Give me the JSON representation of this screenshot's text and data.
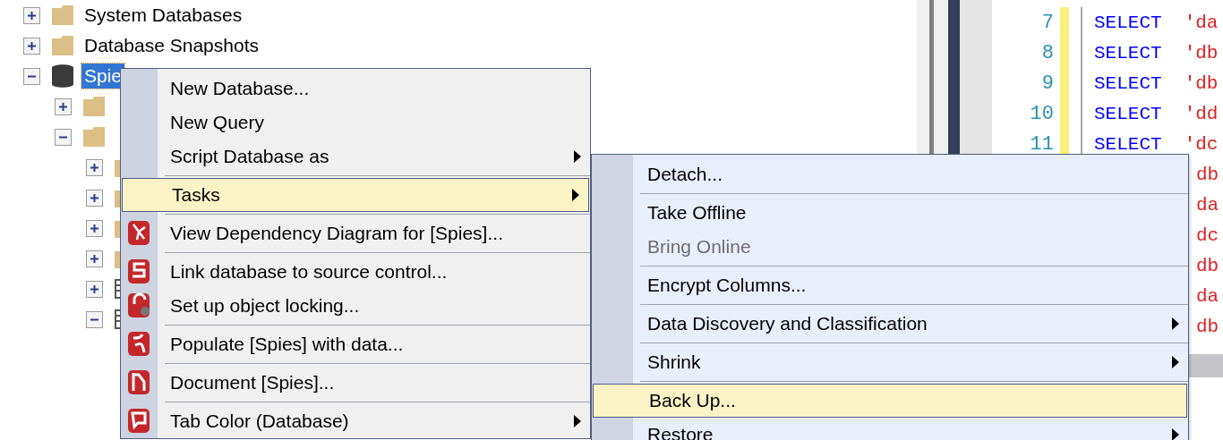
{
  "object_explorer": {
    "nodes": [
      {
        "label": "System Databases",
        "kind": "folder",
        "expanded": false,
        "selected": false
      },
      {
        "label": "Database Snapshots",
        "kind": "folder",
        "expanded": false,
        "selected": false
      },
      {
        "label": "Spie",
        "kind": "database",
        "expanded": true,
        "selected": true,
        "children": [
          {
            "kind": "folder",
            "expanded": false
          },
          {
            "kind": "folder",
            "expanded": true,
            "children": [
              {
                "kind": "folder",
                "expanded": false
              },
              {
                "kind": "folder",
                "expanded": false
              },
              {
                "kind": "folder",
                "expanded": false
              },
              {
                "kind": "folder",
                "expanded": false
              },
              {
                "kind": "table",
                "expanded": false
              },
              {
                "kind": "table",
                "expanded": true
              }
            ]
          }
        ]
      }
    ]
  },
  "editor": {
    "lines": [
      {
        "number": "7",
        "keyword": "SELECT",
        "string": "'da"
      },
      {
        "number": "8",
        "keyword": "SELECT",
        "string": "'db"
      },
      {
        "number": "9",
        "keyword": "SELECT",
        "string": "'db"
      },
      {
        "number": "10",
        "keyword": "SELECT",
        "string": "'dd"
      },
      {
        "number": "11",
        "keyword": "SELECT",
        "string": "'dc"
      },
      {
        "string": "db"
      },
      {
        "string": "da"
      },
      {
        "string": "dc"
      },
      {
        "string": "db"
      },
      {
        "string": "da"
      },
      {
        "string": "db"
      }
    ]
  },
  "context_menu": {
    "items": [
      {
        "kind": "item",
        "label": "New Database...",
        "submenu": false,
        "highlighted": false
      },
      {
        "kind": "item",
        "label": "New Query",
        "submenu": false,
        "highlighted": false
      },
      {
        "kind": "item",
        "label": "Script Database as",
        "submenu": true,
        "highlighted": false
      },
      {
        "kind": "separator"
      },
      {
        "kind": "item",
        "label": "Tasks",
        "submenu": true,
        "highlighted": true
      },
      {
        "kind": "separator"
      },
      {
        "kind": "item",
        "label": "View Dependency Diagram for [Spies]...",
        "submenu": false,
        "highlighted": false
      },
      {
        "kind": "separator"
      },
      {
        "kind": "item",
        "label": "Link database to source control...",
        "submenu": false,
        "highlighted": false
      },
      {
        "kind": "item",
        "label": "Set up object locking...",
        "submenu": false,
        "highlighted": false
      },
      {
        "kind": "separator"
      },
      {
        "kind": "item",
        "label": "Populate [Spies] with data...",
        "submenu": false,
        "highlighted": false
      },
      {
        "kind": "separator"
      },
      {
        "kind": "item",
        "label": "Document [Spies]...",
        "submenu": false,
        "highlighted": false
      },
      {
        "kind": "separator"
      },
      {
        "kind": "item",
        "label": "Tab Color (Database)",
        "submenu": true,
        "highlighted": false
      }
    ]
  },
  "tasks_submenu": {
    "items": [
      {
        "kind": "item",
        "label": "Detach...",
        "submenu": false,
        "highlighted": false,
        "disabled": false
      },
      {
        "kind": "separator"
      },
      {
        "kind": "item",
        "label": "Take Offline",
        "submenu": false,
        "highlighted": false,
        "disabled": false
      },
      {
        "kind": "item",
        "label": "Bring Online",
        "submenu": false,
        "highlighted": false,
        "disabled": true
      },
      {
        "kind": "separator"
      },
      {
        "kind": "item",
        "label": "Encrypt Columns...",
        "submenu": false,
        "highlighted": false,
        "disabled": false
      },
      {
        "kind": "separator"
      },
      {
        "kind": "item",
        "label": "Data Discovery and Classification",
        "submenu": true,
        "highlighted": false,
        "disabled": false
      },
      {
        "kind": "separator"
      },
      {
        "kind": "item",
        "label": "Shrink",
        "submenu": true,
        "highlighted": false,
        "disabled": false
      },
      {
        "kind": "separator"
      },
      {
        "kind": "item",
        "label": "Back Up...",
        "submenu": false,
        "highlighted": true,
        "disabled": false
      },
      {
        "kind": "item",
        "label": "Restore",
        "submenu": true,
        "highlighted": false,
        "disabled": false
      }
    ]
  }
}
